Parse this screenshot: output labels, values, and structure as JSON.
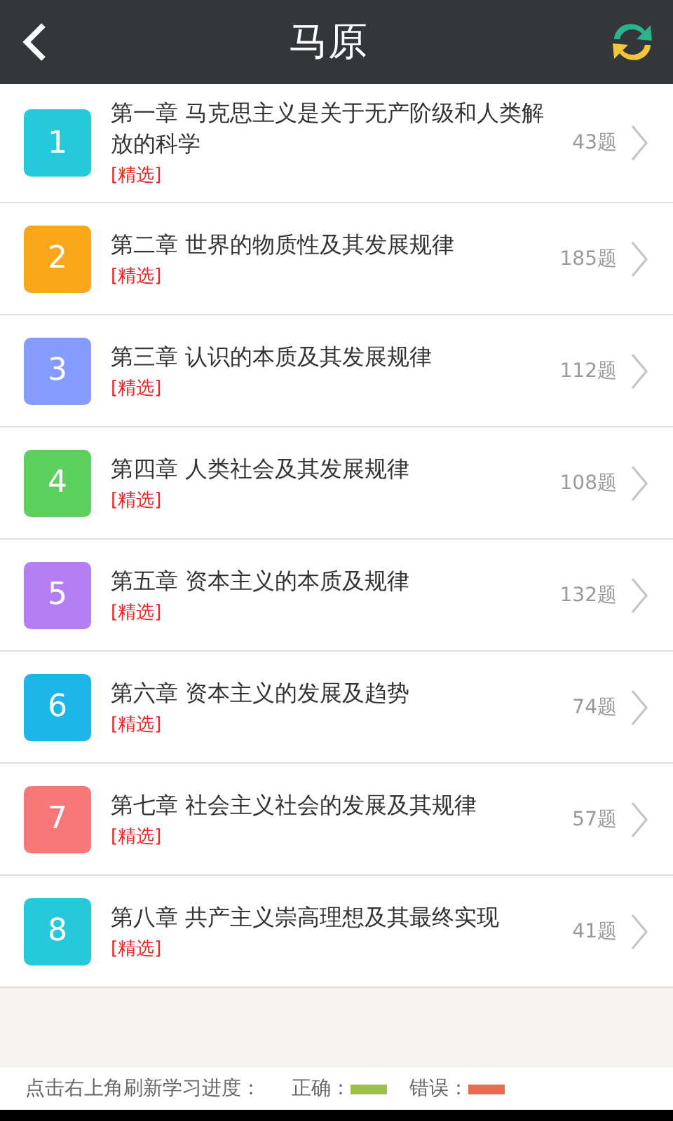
{
  "header": {
    "title": "马原"
  },
  "chapters": [
    {
      "number": "1",
      "color": "#26c9dc",
      "title": "第一章 马克思主义是关于无产阶级和人类解放的科学",
      "tag": "[精选]",
      "count": "43题"
    },
    {
      "number": "2",
      "color": "#f9a61b",
      "title": "第二章 世界的物质性及其发展规律",
      "tag": "[精选]",
      "count": "185题"
    },
    {
      "number": "3",
      "color": "#859bff",
      "title": "第三章 认识的本质及其发展规律",
      "tag": "[精选]",
      "count": "112题"
    },
    {
      "number": "4",
      "color": "#5ccf5c",
      "title": "第四章 人类社会及其发展规律",
      "tag": "[精选]",
      "count": "108题"
    },
    {
      "number": "5",
      "color": "#b57ef3",
      "title": "第五章 资本主义的本质及规律",
      "tag": "[精选]",
      "count": "132题"
    },
    {
      "number": "6",
      "color": "#1cb6ea",
      "title": "第六章 资本主义的发展及趋势",
      "tag": "[精选]",
      "count": "74题"
    },
    {
      "number": "7",
      "color": "#f87878",
      "title": "第七章 社会主义社会的发展及其规律",
      "tag": "[精选]",
      "count": "57题"
    },
    {
      "number": "8",
      "color": "#26c9dc",
      "title": "第八章 共产主义崇高理想及其最终实现",
      "tag": "[精选]",
      "count": "41题"
    }
  ],
  "footer": {
    "hint": "点击右上角刷新学习进度：",
    "legend": [
      {
        "label": "正确：",
        "color": "#9cc04a"
      },
      {
        "label": "错误：",
        "color": "#e86a50"
      }
    ]
  }
}
